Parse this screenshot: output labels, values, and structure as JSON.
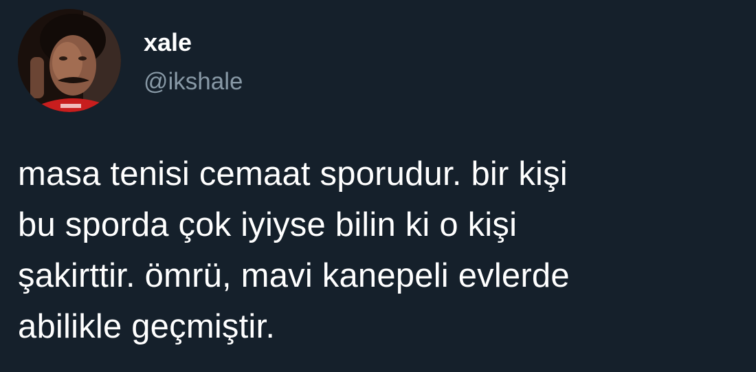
{
  "author": {
    "display_name": "xale",
    "handle": "@ikshale",
    "avatar_icon": "profile-photo"
  },
  "tweet": {
    "lines": [
      "masa tenisi cemaat sporudur. bir kişi",
      "bu sporda çok iyiyse bilin ki o kişi",
      "şakirttir. ömrü, mavi kanepeli evlerde",
      "abilikle geçmiştir."
    ]
  },
  "colors": {
    "background": "#15202b",
    "text_primary": "#ffffff",
    "text_secondary": "#8899a6"
  }
}
